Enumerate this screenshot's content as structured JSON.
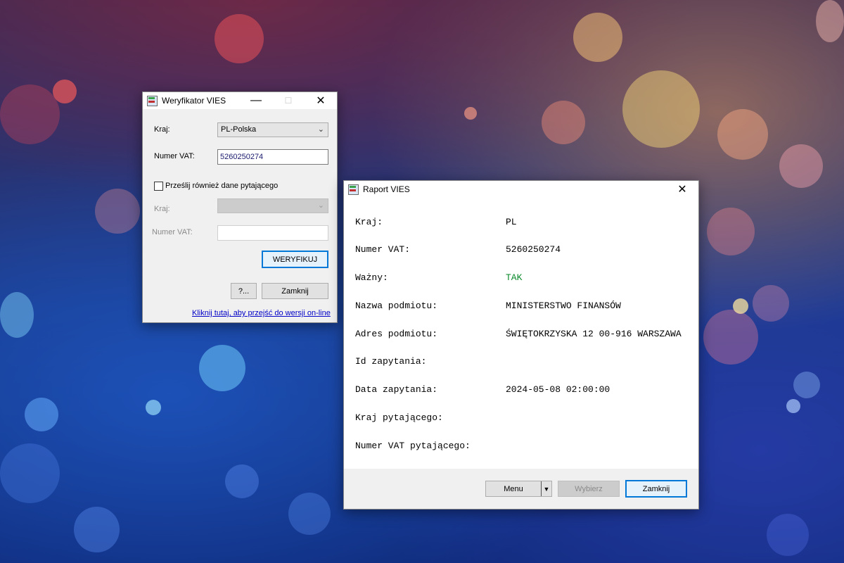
{
  "verifier": {
    "title": "Weryfikator VIES",
    "country_label": "Kraj:",
    "country_value": "PL-Polska",
    "vat_label": "Numer VAT:",
    "vat_value": "5260250274",
    "send_requester_label": "Prześlij również dane pytającego",
    "send_requester_checked": false,
    "req_country_label": "Kraj:",
    "req_country_value": "",
    "req_vat_label": "Numer VAT:",
    "req_vat_value": "",
    "verify_button": "WERYFIKUJ",
    "help_button": "?...",
    "close_button": "Zamknij",
    "online_link": "Kliknij tutaj, aby przejść do wersji on-line"
  },
  "report": {
    "title": "Raport VIES",
    "rows": [
      {
        "label": "Kraj:",
        "value": "PL"
      },
      {
        "label": "Numer VAT:",
        "value": "5260250274"
      },
      {
        "label": "Ważny:",
        "value": "TAK"
      },
      {
        "label": "Nazwa podmiotu:",
        "value": "MINISTERSTWO FINANSÓW"
      },
      {
        "label": "Adres podmiotu:",
        "value": "ŚWIĘTOKRZYSKA 12 00-916 WARSZAWA"
      },
      {
        "label": "Id zapytania:",
        "value": ""
      },
      {
        "label": "Data zapytania:",
        "value": "2024-05-08 02:00:00"
      },
      {
        "label": "Kraj pytającego:",
        "value": ""
      },
      {
        "label": "Numer VAT pytającego:",
        "value": ""
      }
    ],
    "menu_button": "Menu",
    "select_button": "Wybierz",
    "close_button": "Zamknij"
  },
  "colors": {
    "valid_text": "#0a8a2a",
    "default_button_border": "#0078d7",
    "link": "#0000c8"
  }
}
